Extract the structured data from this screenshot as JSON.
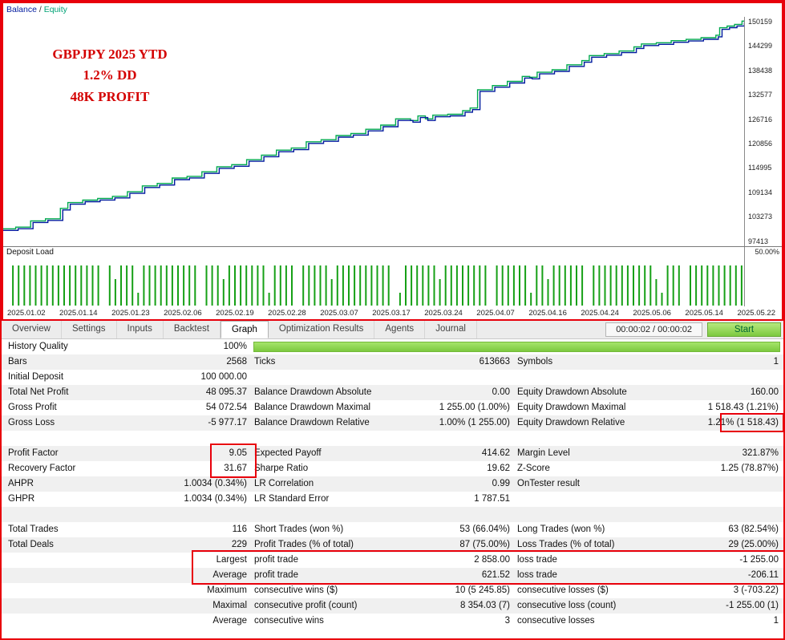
{
  "accent_colors": {
    "annotation_red": "#d40000",
    "balance_line": "#001a9e",
    "equity_line": "#00a94f",
    "deposit_bar_green": "#16a016",
    "quality_bar_green": "#7cc93f",
    "start_button_green": "#7cc93f"
  },
  "chart": {
    "legend": {
      "balance_label": "Balance",
      "separator": " / ",
      "equity_label": "Equity"
    },
    "annotation_lines": [
      "GBPJPY 2025 YTD",
      "1.2% DD",
      "48K PROFIT"
    ],
    "deposit_load": {
      "label": "Deposit Load",
      "scale_label": "50.00%"
    }
  },
  "chart_data": {
    "type": "line",
    "title": "Balance / Equity curve",
    "legend_position": "top-left",
    "grid": false,
    "y_axis_side": "right",
    "ylim": [
      96200,
      151300
    ],
    "y_ticks": [
      "150159",
      "144299",
      "138438",
      "132577",
      "126716",
      "120856",
      "114995",
      "109134",
      "103273",
      "97413"
    ],
    "x_ticks": [
      "2025.01.02",
      "2025.01.14",
      "2025.01.23",
      "2025.02.06",
      "2025.02.19",
      "2025.02.28",
      "2025.03.07",
      "2025.03.17",
      "2025.03.24",
      "2025.04.07",
      "2025.04.16",
      "2025.04.24",
      "2025.05.06",
      "2025.05.14",
      "2025.05.22"
    ],
    "series": [
      {
        "name": "Balance",
        "color": "#001a9e"
      },
      {
        "name": "Equity",
        "color": "#00a94f"
      }
    ],
    "points": [
      [
        0.0,
        100000
      ],
      [
        0.02,
        100400
      ],
      [
        0.04,
        101900
      ],
      [
        0.06,
        102400
      ],
      [
        0.08,
        104900
      ],
      [
        0.09,
        106300
      ],
      [
        0.11,
        106900
      ],
      [
        0.13,
        107300
      ],
      [
        0.15,
        107800
      ],
      [
        0.17,
        108900
      ],
      [
        0.19,
        110300
      ],
      [
        0.21,
        110900
      ],
      [
        0.23,
        112200
      ],
      [
        0.25,
        112600
      ],
      [
        0.27,
        113700
      ],
      [
        0.29,
        114900
      ],
      [
        0.31,
        115400
      ],
      [
        0.33,
        116600
      ],
      [
        0.35,
        117700
      ],
      [
        0.37,
        118900
      ],
      [
        0.39,
        119400
      ],
      [
        0.41,
        120900
      ],
      [
        0.43,
        121400
      ],
      [
        0.45,
        122400
      ],
      [
        0.47,
        122900
      ],
      [
        0.49,
        123900
      ],
      [
        0.51,
        124900
      ],
      [
        0.53,
        126400
      ],
      [
        0.55,
        126000
      ],
      [
        0.56,
        127100
      ],
      [
        0.57,
        126400
      ],
      [
        0.58,
        127300
      ],
      [
        0.6,
        127500
      ],
      [
        0.62,
        128400
      ],
      [
        0.63,
        129000
      ],
      [
        0.64,
        133400
      ],
      [
        0.66,
        134400
      ],
      [
        0.68,
        135400
      ],
      [
        0.7,
        136600
      ],
      [
        0.71,
        136400
      ],
      [
        0.72,
        137600
      ],
      [
        0.74,
        138200
      ],
      [
        0.76,
        139400
      ],
      [
        0.78,
        140400
      ],
      [
        0.79,
        141600
      ],
      [
        0.81,
        142100
      ],
      [
        0.83,
        142700
      ],
      [
        0.85,
        143700
      ],
      [
        0.86,
        144400
      ],
      [
        0.88,
        144700
      ],
      [
        0.9,
        145200
      ],
      [
        0.92,
        145500
      ],
      [
        0.94,
        145900
      ],
      [
        0.96,
        146500
      ],
      [
        0.965,
        148300
      ],
      [
        0.975,
        148700
      ],
      [
        0.985,
        149100
      ],
      [
        0.995,
        149900
      ],
      [
        1.0,
        150159
      ]
    ]
  },
  "tabs": [
    {
      "label": "Overview",
      "active": false
    },
    {
      "label": "Settings",
      "active": false
    },
    {
      "label": "Inputs",
      "active": false
    },
    {
      "label": "Backtest",
      "active": false
    },
    {
      "label": "Graph",
      "active": true
    },
    {
      "label": "Optimization Results",
      "active": false
    },
    {
      "label": "Agents",
      "active": false
    },
    {
      "label": "Journal",
      "active": false
    }
  ],
  "toolbar": {
    "elapsed": "00:00:02 / 00:00:02",
    "start_label": "Start"
  },
  "stats": {
    "rows": [
      {
        "shaded": false,
        "bar": 100,
        "c": [
          "History Quality",
          "100%"
        ]
      },
      {
        "shaded": true,
        "c": [
          "Bars",
          "2568",
          "Ticks",
          "613663",
          "Symbols",
          "1"
        ]
      },
      {
        "shaded": false,
        "c": [
          "Initial Deposit",
          "100 000.00",
          "",
          "",
          "",
          ""
        ]
      },
      {
        "shaded": true,
        "c": [
          "Total Net Profit",
          "48 095.37",
          "Balance Drawdown Absolute",
          "0.00",
          "Equity Drawdown Absolute",
          "160.00"
        ]
      },
      {
        "shaded": false,
        "c": [
          "Gross Profit",
          "54 072.54",
          "Balance Drawdown Maximal",
          "1 255.00 (1.00%)",
          "Equity Drawdown Maximal",
          "1 518.43 (1.21%)"
        ]
      },
      {
        "shaded": true,
        "c": [
          "Gross Loss",
          "-5 977.17",
          "Balance Drawdown Relative",
          "1.00% (1 255.00)",
          "Equity Drawdown Relative",
          "1.21% (1 518.43)"
        ]
      },
      {
        "shaded": false,
        "empty": true
      },
      {
        "shaded": true,
        "c": [
          "Profit Factor",
          "9.05",
          "Expected Payoff",
          "414.62",
          "Margin Level",
          "321.87%"
        ]
      },
      {
        "shaded": false,
        "c": [
          "Recovery Factor",
          "31.67",
          "Sharpe Ratio",
          "19.62",
          "Z-Score",
          "1.25 (78.87%)"
        ]
      },
      {
        "shaded": true,
        "c": [
          "AHPR",
          "1.0034 (0.34%)",
          "LR Correlation",
          "0.99",
          "OnTester result",
          ""
        ]
      },
      {
        "shaded": false,
        "c": [
          "GHPR",
          "1.0034 (0.34%)",
          "LR Standard Error",
          "1 787.51",
          "",
          ""
        ]
      },
      {
        "shaded": true,
        "empty": true
      },
      {
        "shaded": false,
        "c": [
          "Total Trades",
          "116",
          "Short Trades (won %)",
          "53 (66.04%)",
          "Long Trades (won %)",
          "63 (82.54%)"
        ]
      },
      {
        "shaded": true,
        "c": [
          "Total Deals",
          "229",
          "Profit Trades (% of total)",
          "87 (75.00%)",
          "Loss Trades (% of total)",
          "29 (25.00%)"
        ]
      },
      {
        "shaded": false,
        "label2": true,
        "c": [
          "",
          "Largest",
          "profit trade",
          "2 858.00",
          "loss trade",
          "-1 255.00"
        ]
      },
      {
        "shaded": true,
        "label2": true,
        "c": [
          "",
          "Average",
          "profit trade",
          "621.52",
          "loss trade",
          "-206.11"
        ]
      },
      {
        "shaded": false,
        "label2": true,
        "c": [
          "",
          "Maximum",
          "consecutive wins ($)",
          "10 (5 245.85)",
          "consecutive losses ($)",
          "3 (-703.22)"
        ]
      },
      {
        "shaded": true,
        "label2": true,
        "c": [
          "",
          "Maximal",
          "consecutive profit (count)",
          "8 354.03 (7)",
          "consecutive loss (count)",
          "-1 255.00 (1)"
        ]
      },
      {
        "shaded": false,
        "label2": true,
        "c": [
          "",
          "Average",
          "consecutive wins",
          "3",
          "consecutive losses",
          "1"
        ]
      }
    ]
  }
}
